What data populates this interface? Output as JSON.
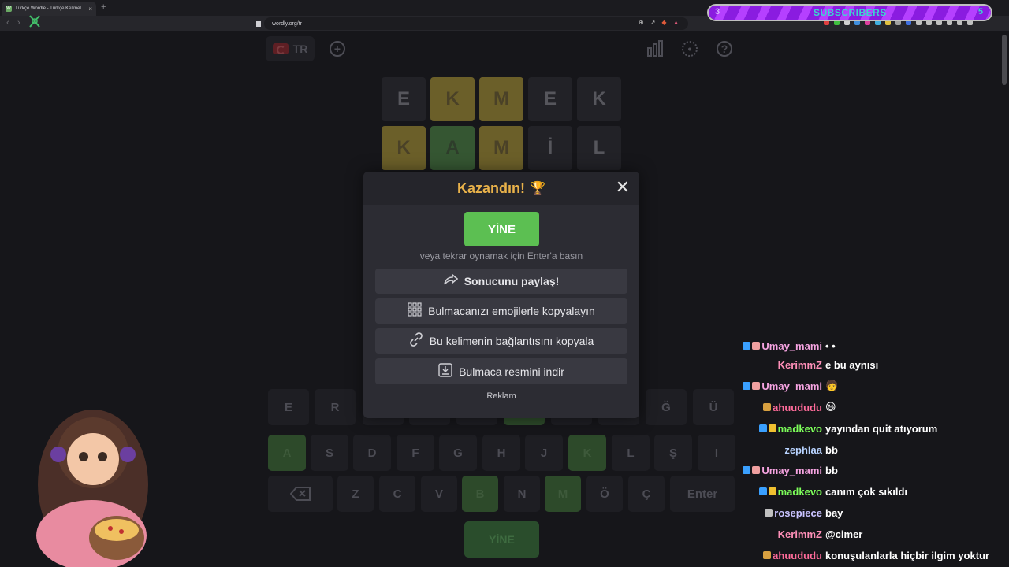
{
  "browser": {
    "tab_title": "Türkçe Wordle - Türkçe Kelimel",
    "tab_close": "×",
    "new_tab": "+",
    "url": "wordly.org/tr",
    "back": "‹",
    "forward": "›"
  },
  "overlay": {
    "count_left": "3",
    "label": "SUBSCRIBERS",
    "count_right": "5"
  },
  "game": {
    "language": "TR",
    "board": [
      [
        {
          "l": "E",
          "s": "d"
        },
        {
          "l": "K",
          "s": "y"
        },
        {
          "l": "M",
          "s": "y"
        },
        {
          "l": "E",
          "s": "d"
        },
        {
          "l": "K",
          "s": "d"
        }
      ],
      [
        {
          "l": "K",
          "s": "y"
        },
        {
          "l": "A",
          "s": "g"
        },
        {
          "l": "M",
          "s": "y"
        },
        {
          "l": "İ",
          "s": "d"
        },
        {
          "l": "L",
          "s": "d"
        }
      ]
    ],
    "keyboard": {
      "row1": [
        "E",
        "R",
        "",
        "",
        "",
        "",
        "",
        "",
        "Ğ",
        "Ü"
      ],
      "row2": [
        "A",
        "S",
        "D",
        "F",
        "G",
        "H",
        "J",
        "K",
        "L",
        "Ş",
        "I"
      ],
      "row3": [
        "Z",
        "C",
        "V",
        "B",
        "N",
        "M",
        "Ö",
        "Ç"
      ],
      "enter": "Enter",
      "backspace": "⌫"
    },
    "replay_bottom": "YİNE"
  },
  "modal": {
    "title": "Kazandın!",
    "trophy": "🏆",
    "close": "✕",
    "again": "YİNE",
    "hint": "veya tekrar oynamak için Enter'a basın",
    "share": "Sonucunu paylaş!",
    "copy_emoji": "Bulmacanızı emojilerle kopyalayın",
    "copy_link": "Bu kelimenin bağlantısını kopyala",
    "download": "Bulmaca resmini indir",
    "ad": "Reklam"
  },
  "chat": [
    {
      "user": "Umay_mami",
      "color": "#f5a3e0",
      "msg": "• •"
    },
    {
      "user": "KerimmZ",
      "color": "#ff8fb8",
      "msg": "e bu aynısı"
    },
    {
      "user": "Umay_mami",
      "color": "#f5a3e0",
      "msg": "🧑"
    },
    {
      "user": "ahuududu",
      "color": "#ff6b9a",
      "msg": "😃"
    },
    {
      "user": "madkevo",
      "color": "#7dff5a",
      "msg": "yayından quit atıyorum"
    },
    {
      "user": "zephlaa",
      "color": "#b8d3ff",
      "msg": "bb"
    },
    {
      "user": "Umay_mami",
      "color": "#f5a3e0",
      "msg": "bb"
    },
    {
      "user": "madkevo",
      "color": "#7dff5a",
      "msg": "canım çok sıkıldı"
    },
    {
      "user": "rosepiece",
      "color": "#c9c3ff",
      "msg": "bay"
    },
    {
      "user": "KerimmZ",
      "color": "#ff8fb8",
      "msg": "@cimer"
    },
    {
      "user": "ahuududu",
      "color": "#ff6b9a",
      "msg": "konuşulanlarla hiçbir ilgim yoktur"
    }
  ]
}
